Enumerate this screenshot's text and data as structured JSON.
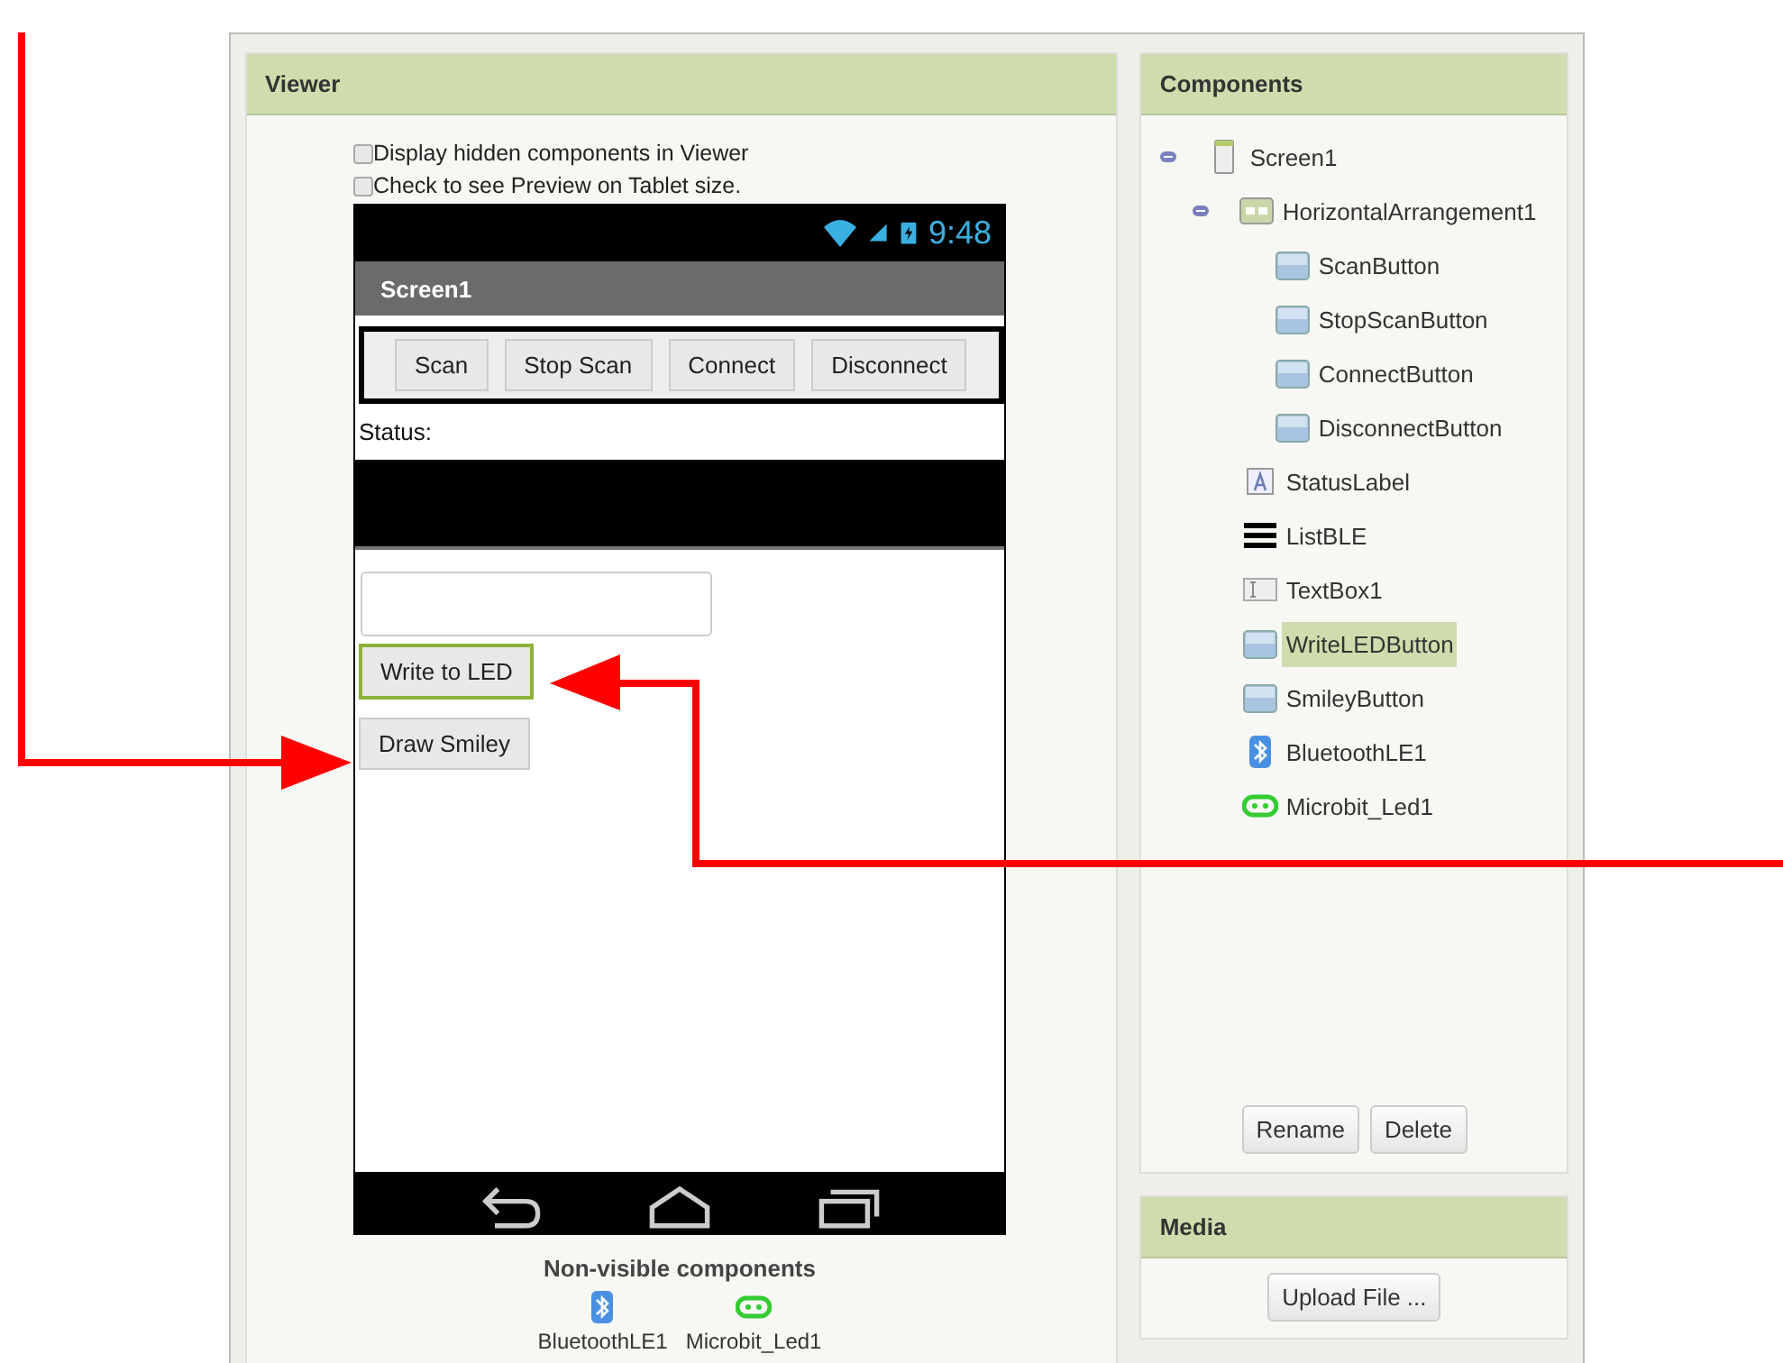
{
  "viewer": {
    "title": "Viewer",
    "checkboxes": [
      {
        "label": "Display hidden components in Viewer",
        "checked": false
      },
      {
        "label": "Check to see Preview on Tablet size.",
        "checked": false
      }
    ],
    "phone": {
      "time": "9:48",
      "screen_title": "Screen1",
      "components": [
        {
          "kind": "arrangement",
          "buttons": [
            {
              "label": "Scan"
            },
            {
              "label": "Stop Scan"
            },
            {
              "label": "Connect"
            },
            {
              "label": "Disconnect"
            }
          ]
        },
        {
          "kind": "label",
          "text": "Status:"
        },
        {
          "kind": "list"
        },
        {
          "kind": "textbox"
        },
        {
          "kind": "button",
          "label": "Write to LED",
          "selected": true
        },
        {
          "kind": "button",
          "label": "Draw Smiley",
          "selected": false
        }
      ]
    },
    "non_visible": {
      "title": "Non-visible components",
      "items": [
        {
          "kind": "bluetooth",
          "label": "BluetoothLE1"
        },
        {
          "kind": "microbit",
          "label": "Microbit_Led1"
        }
      ]
    }
  },
  "components": {
    "title": "Components",
    "tree": [
      {
        "kind": "screen",
        "label": "Screen1",
        "selected": false,
        "expanded": true,
        "children": [
          {
            "kind": "arrangement",
            "label": "HorizontalArrangement1",
            "selected": false,
            "expanded": true,
            "children": [
              {
                "kind": "button",
                "label": "ScanButton",
                "selected": false
              },
              {
                "kind": "button",
                "label": "StopScanButton",
                "selected": false
              },
              {
                "kind": "button",
                "label": "ConnectButton",
                "selected": false
              },
              {
                "kind": "button",
                "label": "DisconnectButton",
                "selected": false
              }
            ]
          },
          {
            "kind": "label",
            "label": "StatusLabel",
            "selected": false
          },
          {
            "kind": "list",
            "label": "ListBLE",
            "selected": false
          },
          {
            "kind": "textbox",
            "label": "TextBox1",
            "selected": false
          },
          {
            "kind": "button",
            "label": "WriteLEDButton",
            "selected": true
          },
          {
            "kind": "button",
            "label": "SmileyButton",
            "selected": false
          },
          {
            "kind": "bluetooth",
            "label": "BluetoothLE1",
            "selected": false
          },
          {
            "kind": "microbit",
            "label": "Microbit_Led1",
            "selected": false
          }
        ]
      }
    ],
    "buttons": [
      "Rename",
      "Delete"
    ]
  },
  "media": {
    "title": "Media",
    "button": "Upload File ..."
  }
}
